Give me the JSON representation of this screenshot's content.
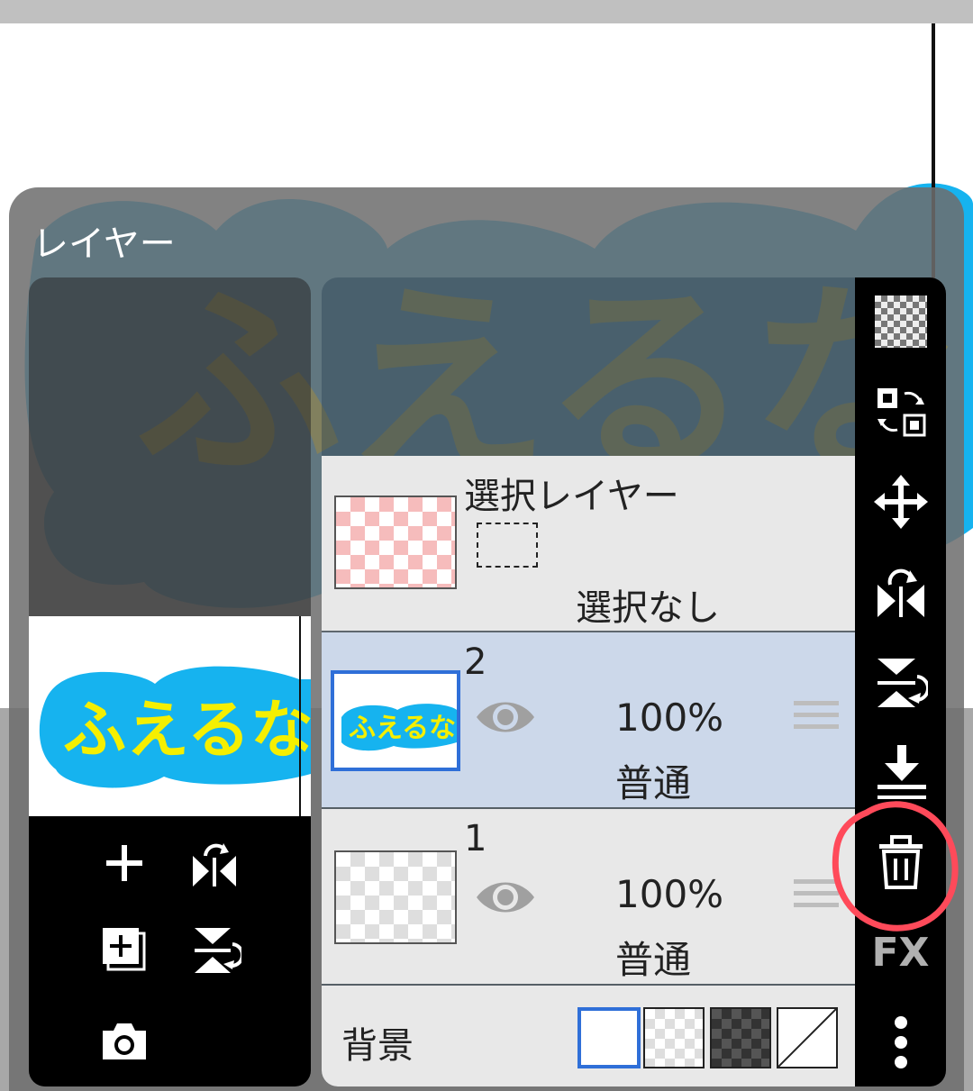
{
  "panel": {
    "title": "レイヤー"
  },
  "selection_layer": {
    "title": "選択レイヤー",
    "status": "選択なし"
  },
  "layers": [
    {
      "name": "2",
      "opacity": "100%",
      "blend": "普通",
      "thumb_text": "ふえるな",
      "selected": true
    },
    {
      "name": "1",
      "opacity": "100%",
      "blend": "普通",
      "selected": false
    }
  ],
  "background": {
    "label": "背景",
    "options": [
      "white",
      "light-checker",
      "dark-checker",
      "none"
    ],
    "selected": "white"
  },
  "canvas_text": "ふえるな",
  "right_toolbar": [
    "transparency-checker-icon",
    "swap-layer-icon",
    "move-icon",
    "flip-horizontal-icon",
    "flip-vertical-icon",
    "merge-down-icon",
    "trash-icon",
    "fx",
    "more-icon"
  ],
  "fx_label": "FX",
  "colors": {
    "selected_row": "#ccd8ea",
    "accent_blue": "#2f6fd8",
    "highlight_circle": "#ff4a5a",
    "text_yellow": "#f5ef00",
    "text_outline": "#16b3ef"
  }
}
